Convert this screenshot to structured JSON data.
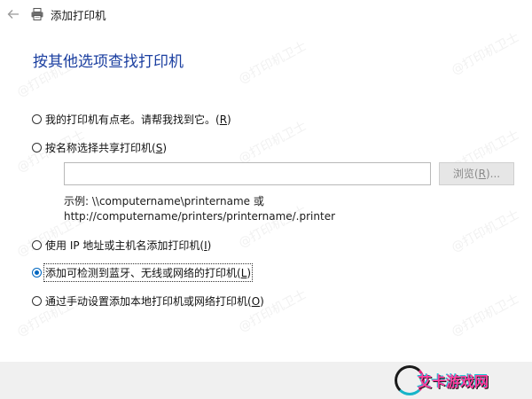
{
  "window": {
    "title": "添加打印机"
  },
  "page": {
    "heading": "按其他选项查找打印机"
  },
  "options": [
    {
      "pre": "我的打印机有点老。请帮我找到它。(",
      "key": "R",
      "post": ")",
      "selected": false
    },
    {
      "pre": "按名称选择共享打印机(",
      "key": "S",
      "post": ")",
      "selected": false
    },
    {
      "pre": "使用 IP 地址或主机名添加打印机(",
      "key": "I",
      "post": ")",
      "selected": false
    },
    {
      "pre": "添加可检测到蓝牙、无线或网络的打印机(",
      "key": "L",
      "post": ")",
      "selected": true
    },
    {
      "pre": "通过手动设置添加本地打印机或网络打印机(",
      "key": "O",
      "post": ")",
      "selected": false
    }
  ],
  "shared": {
    "input_value": "",
    "browse_pre": "浏览(",
    "browse_key": "R",
    "browse_post": ")...",
    "example_line1": "示例: \\\\computername\\printername 或",
    "example_line2": "http://computername/printers/printername/.printer"
  },
  "watermark": {
    "text": "@打印机卫士"
  },
  "brand": {
    "text": "艾卡游戏网"
  },
  "icons": {
    "back": "back-arrow-icon",
    "printer": "printer-icon"
  },
  "colors": {
    "heading": "#1b3fa0",
    "accent": "#0067c0",
    "footer": "#f0f0f0"
  }
}
